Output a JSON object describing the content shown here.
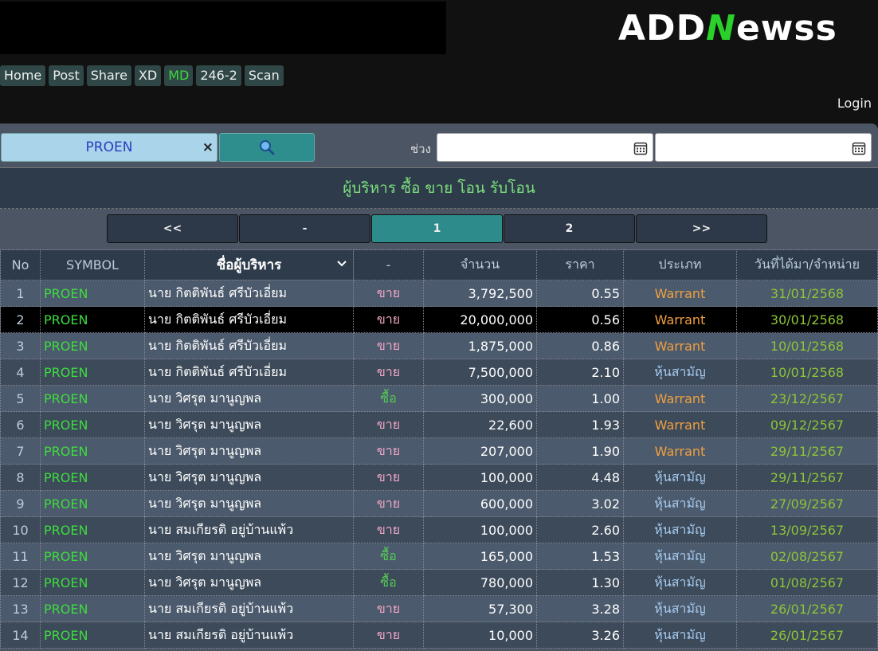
{
  "brand": {
    "logo_pre": "ADD",
    "logo_n": "N",
    "logo_post": "ewss"
  },
  "nav": [
    "Home",
    "Post",
    "Share",
    "XD",
    "MD",
    "246-2",
    "Scan"
  ],
  "login_label": "Login",
  "search": {
    "value": "PROEN",
    "clear": "×"
  },
  "range_label": "ช่วง",
  "section_title": "ผู้บริหาร ซื้อ ขาย โอน รับโอน",
  "pager": [
    "<<",
    "-",
    "1",
    "2",
    ">>"
  ],
  "columns": [
    "No",
    "SYMBOL",
    "ชื่อผู้บริหาร",
    "-",
    "จำนวน",
    "ราคา",
    "ประเภท",
    "วันที่ได้มา/จำหน่าย"
  ],
  "rows": [
    {
      "no": "1",
      "symbol": "PROEN",
      "name": "นาย กิตติพันธ์ ศรีบัวเอี่ยม",
      "action": "ขาย",
      "amount": "3,792,500",
      "price": "0.55",
      "type": "Warrant",
      "date": "31/01/2568"
    },
    {
      "no": "2",
      "symbol": "PROEN",
      "name": "นาย กิตติพันธ์ ศรีบัวเอี่ยม",
      "action": "ขาย",
      "amount": "20,000,000",
      "price": "0.56",
      "type": "Warrant",
      "date": "30/01/2568"
    },
    {
      "no": "3",
      "symbol": "PROEN",
      "name": "นาย กิตติพันธ์ ศรีบัวเอี่ยม",
      "action": "ขาย",
      "amount": "1,875,000",
      "price": "0.86",
      "type": "Warrant",
      "date": "10/01/2568"
    },
    {
      "no": "4",
      "symbol": "PROEN",
      "name": "นาย กิตติพันธ์ ศรีบัวเอี่ยม",
      "action": "ขาย",
      "amount": "7,500,000",
      "price": "2.10",
      "type": "หุ้นสามัญ",
      "date": "10/01/2568"
    },
    {
      "no": "5",
      "symbol": "PROEN",
      "name": "นาย วิศรุต มานูญพล",
      "action": "ซื้อ",
      "amount": "300,000",
      "price": "1.00",
      "type": "Warrant",
      "date": "23/12/2567"
    },
    {
      "no": "6",
      "symbol": "PROEN",
      "name": "นาย วิศรุต มานูญพล",
      "action": "ขาย",
      "amount": "22,600",
      "price": "1.93",
      "type": "Warrant",
      "date": "09/12/2567"
    },
    {
      "no": "7",
      "symbol": "PROEN",
      "name": "นาย วิศรุต มานูญพล",
      "action": "ขาย",
      "amount": "207,000",
      "price": "1.90",
      "type": "Warrant",
      "date": "29/11/2567"
    },
    {
      "no": "8",
      "symbol": "PROEN",
      "name": "นาย วิศรุต มานูญพล",
      "action": "ขาย",
      "amount": "100,000",
      "price": "4.48",
      "type": "หุ้นสามัญ",
      "date": "29/11/2567"
    },
    {
      "no": "9",
      "symbol": "PROEN",
      "name": "นาย วิศรุต มานูญพล",
      "action": "ขาย",
      "amount": "600,000",
      "price": "3.02",
      "type": "หุ้นสามัญ",
      "date": "27/09/2567"
    },
    {
      "no": "10",
      "symbol": "PROEN",
      "name": "นาย สมเกียรติ อยู่บ้านแพ้ว",
      "action": "ขาย",
      "amount": "100,000",
      "price": "2.60",
      "type": "หุ้นสามัญ",
      "date": "13/09/2567"
    },
    {
      "no": "11",
      "symbol": "PROEN",
      "name": "นาย วิศรุต มานูญพล",
      "action": "ซื้อ",
      "amount": "165,000",
      "price": "1.53",
      "type": "หุ้นสามัญ",
      "date": "02/08/2567"
    },
    {
      "no": "12",
      "symbol": "PROEN",
      "name": "นาย วิศรุต มานูญพล",
      "action": "ซื้อ",
      "amount": "780,000",
      "price": "1.30",
      "type": "หุ้นสามัญ",
      "date": "01/08/2567"
    },
    {
      "no": "13",
      "symbol": "PROEN",
      "name": "นาย สมเกียรติ อยู่บ้านแพ้ว",
      "action": "ขาย",
      "amount": "57,300",
      "price": "3.28",
      "type": "หุ้นสามัญ",
      "date": "26/01/2567"
    },
    {
      "no": "14",
      "symbol": "PROEN",
      "name": "นาย สมเกียรติ อยู่บ้านแพ้ว",
      "action": "ขาย",
      "amount": "10,000",
      "price": "3.26",
      "type": "หุ้นสามัญ",
      "date": "26/01/2567"
    }
  ]
}
